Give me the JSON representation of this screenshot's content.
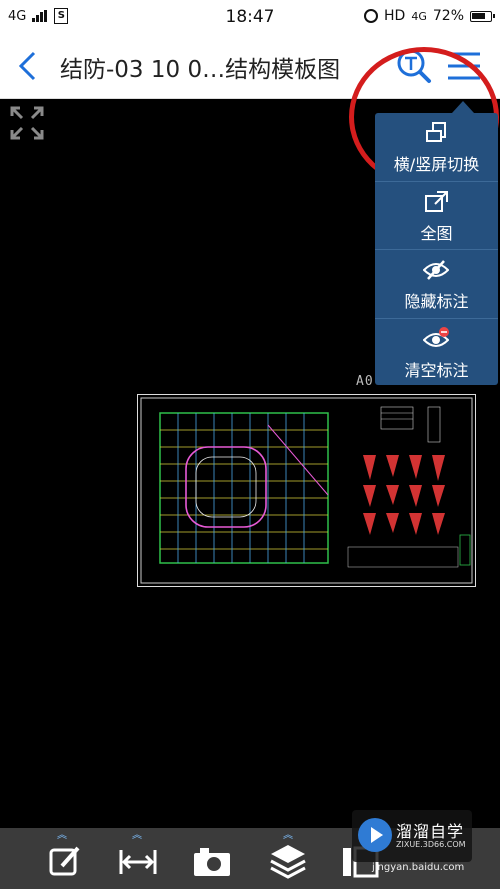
{
  "status_bar": {
    "network_left": "4G",
    "sim_badge": "S",
    "time": "18:47",
    "hd_label": "HD",
    "network_right": "4G",
    "battery": "72%"
  },
  "header": {
    "title": "结防-03 10 0…结构模板图"
  },
  "drawing": {
    "label": "A0-1:80"
  },
  "popup_menu": {
    "items": [
      {
        "label": "横/竖屏切换",
        "icon": "rotate-screen-icon"
      },
      {
        "label": "全图",
        "icon": "fit-view-icon"
      },
      {
        "label": "隐藏标注",
        "icon": "hide-annotation-icon"
      },
      {
        "label": "清空标注",
        "icon": "clear-annotation-icon"
      }
    ]
  },
  "toolbar": {
    "tools": [
      "annotate-icon",
      "measure-icon",
      "camera-icon",
      "layers-icon",
      "layout-icon"
    ]
  },
  "watermark": {
    "name": "溜溜自学",
    "sub": "ZIXUE.3D66.COM",
    "url": "jingyan.baidu.com"
  },
  "colors": {
    "accent": "#1e6fd9",
    "popup_bg": "#25507e",
    "highlight_circle": "#d41d1d",
    "toolbar_bg": "#3b3b3b"
  }
}
